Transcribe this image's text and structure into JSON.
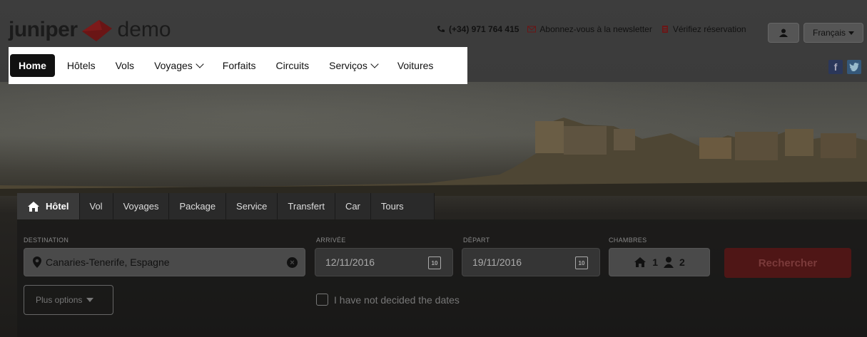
{
  "brand": {
    "word1": "juniper",
    "word2": "demo"
  },
  "topbar": {
    "phone": "(+34) 971 764 415",
    "newsletter": "Abonnez-vous à la newsletter",
    "verify": "Vérifiez réservation",
    "language": "Français"
  },
  "nav": {
    "items": [
      "Home",
      "Hôtels",
      "Vols",
      "Voyages",
      "Forfaits",
      "Circuits",
      "Serviços",
      "Voitures"
    ],
    "active": "Home"
  },
  "social": {
    "facebook": "f",
    "twitter": "t"
  },
  "search_tabs": [
    "Hôtel",
    "Vol",
    "Voyages",
    "Package",
    "Service",
    "Transfert",
    "Car",
    "Tours"
  ],
  "form": {
    "destination_label": "DESTINATION",
    "destination_value": "Canaries-Tenerife,  Espagne",
    "arrival_label": "ARRIVÉE",
    "arrival_value": "12/11/2016",
    "departure_label": "DÉPART",
    "departure_value": "19/11/2016",
    "calendar_day": "10",
    "rooms_label": "CHAMBRES",
    "rooms_count": "1",
    "guests_count": "2",
    "search_button": "Rechercher",
    "more_options": "Plus options",
    "undecided_dates": "I have not decided the dates"
  },
  "colors": {
    "highlight": "#ffffff",
    "accent_red": "#c21e1e",
    "overlay": "#000000"
  }
}
